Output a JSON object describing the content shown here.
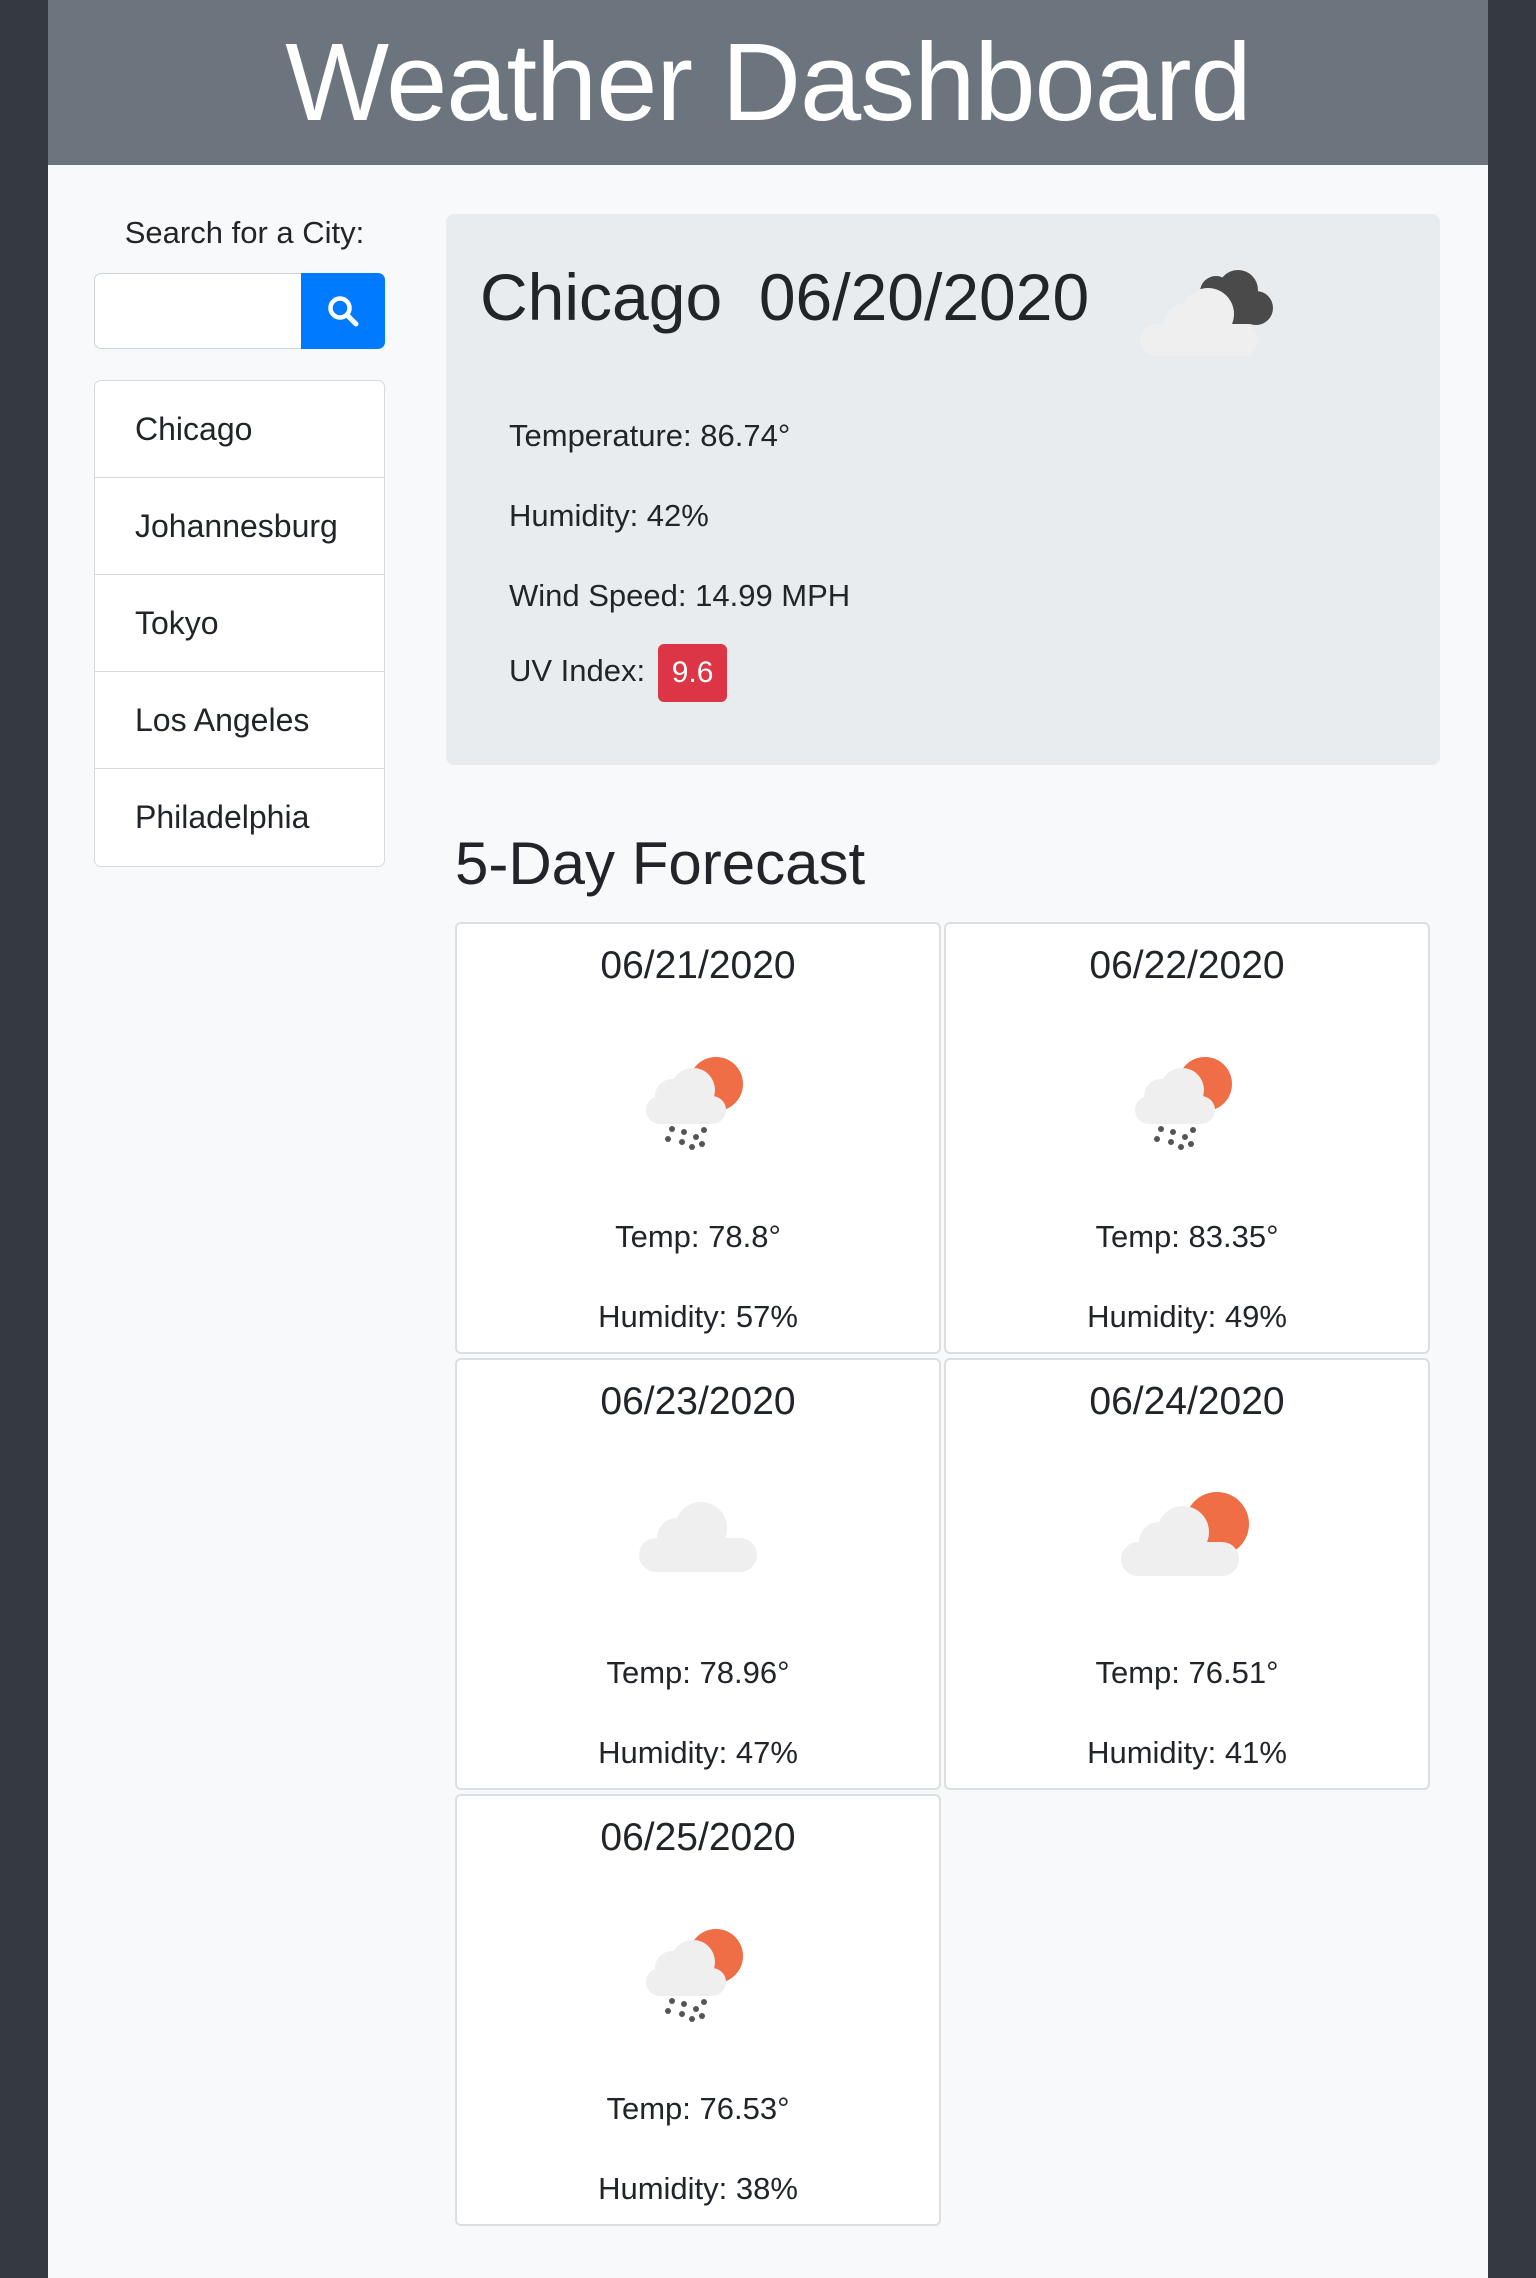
{
  "header": {
    "title": "Weather Dashboard"
  },
  "search": {
    "label": "Search for a City:",
    "value": "",
    "button_icon": "search-icon"
  },
  "history": [
    {
      "label": "Chicago"
    },
    {
      "label": "Johannesburg"
    },
    {
      "label": "Tokyo"
    },
    {
      "label": "Los Angeles"
    },
    {
      "label": "Philadelphia"
    }
  ],
  "current": {
    "title": "Chicago  06/20/2020",
    "icon": "broken-clouds-icon",
    "temperature": "Temperature: 86.74°",
    "humidity": "Humidity: 42%",
    "wind": "Wind Speed: 14.99 MPH",
    "uv_label": "UV Index: ",
    "uv_value": "9.6",
    "uv_color": "#dc3545"
  },
  "forecast": {
    "title": "5-Day Forecast",
    "days": [
      {
        "date": "06/21/2020",
        "icon": "rain-sun-icon",
        "temp": "Temp: 78.8°",
        "humidity": "Humidity: 57%"
      },
      {
        "date": "06/22/2020",
        "icon": "rain-sun-icon",
        "temp": "Temp: 83.35°",
        "humidity": "Humidity: 49%"
      },
      {
        "date": "06/23/2020",
        "icon": "cloud-icon",
        "temp": "Temp: 78.96°",
        "humidity": "Humidity: 47%"
      },
      {
        "date": "06/24/2020",
        "icon": "partly-cloudy-icon",
        "temp": "Temp: 76.51°",
        "humidity": "Humidity: 41%"
      },
      {
        "date": "06/25/2020",
        "icon": "rain-sun-icon",
        "temp": "Temp: 76.53°",
        "humidity": "Humidity: 38%"
      }
    ]
  },
  "colors": {
    "header_bg": "#6c757d",
    "accent": "#007bff",
    "sun": "#ef6e45",
    "cloud": "#efefef",
    "dark_cloud": "#4a4a4a"
  }
}
